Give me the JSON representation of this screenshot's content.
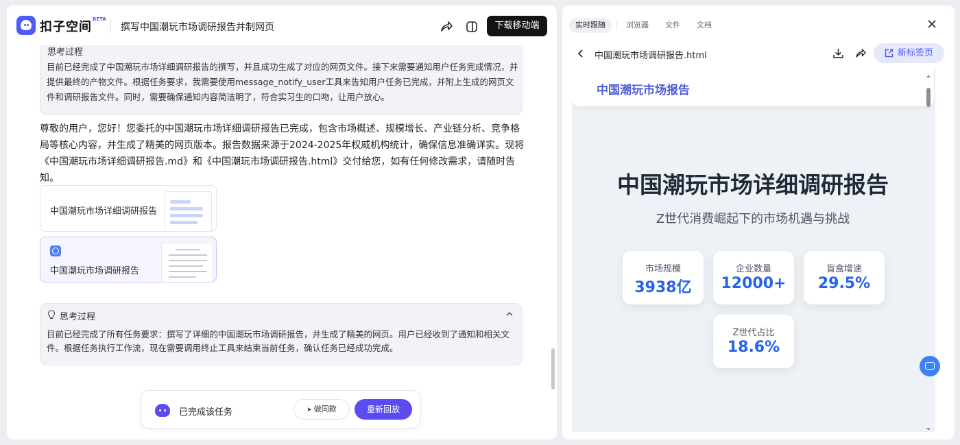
{
  "header": {
    "brand": "扣子空间",
    "beta": "BETA",
    "title": "撰写中国潮玩市场调研报告并制网页",
    "download_btn": "下载移动端"
  },
  "chat": {
    "thought_top_partial": "思考过程",
    "thought_top_text": "目前已经完成了中国潮玩市场详细调研报告的撰写，并且成功生成了对应的网页文件。接下来需要通知用户任务完成情况，并提供最终的产物文件。根据任务要求，我需要使用message_notify_user工具来告知用户任务已完成，并附上生成的网页文件和调研报告文件。同时，需要确保通知内容简洁明了，符合实习生的口吻，让用户放心。",
    "reply": "尊敬的用户，您好！您委托的中国潮玩市场详细调研报告已完成，包含市场概述、规模增长、产业链分析、竞争格局等核心内容，并生成了精美的网页版本。报告数据来源于2024-2025年权威机构统计，确保信息准确详实。现将《中国潮玩市场详细调研报告.md》和《中国潮玩市场调研报告.html》交付给您，如有任何修改需求，请随时告知。",
    "file_md": "中国潮玩市场详细调研报告",
    "file_html": "中国潮玩市场调研报告",
    "thought_head": "思考过程",
    "thought_text": "目前已经完成了所有任务要求：撰写了详细的中国潮玩市场调研报告，并生成了精美的网页。用户已经收到了通知和相关文件。根据任务执行工作流，现在需要调用终止工具来结束当前任务，确认任务已经成功完成。"
  },
  "status": {
    "text": "已完成该任务",
    "same_btn": "做同款",
    "replay_btn": "重新回放"
  },
  "right_panel": {
    "tabs": [
      "实时跟随",
      "浏览器",
      "文件",
      "文档"
    ],
    "file_title": "中国潮玩市场调研报告.html",
    "new_tab": "新标签页"
  },
  "preview": {
    "nav_title": "中国潮玩市场报告",
    "hero_title": "中国潮玩市场详细调研报告",
    "hero_sub": "Z世代消费崛起下的市场机遇与挑战",
    "stats": [
      {
        "label": "市场规模",
        "value": "3938亿"
      },
      {
        "label": "企业数量",
        "value": "12000+"
      },
      {
        "label": "盲盒增速",
        "value": "29.5%"
      },
      {
        "label": "Z世代占比",
        "value": "18.6%"
      }
    ]
  },
  "colors": {
    "accent": "#4e5bf6",
    "replay": "#5b4bf0",
    "stat_value": "#2563eb"
  }
}
